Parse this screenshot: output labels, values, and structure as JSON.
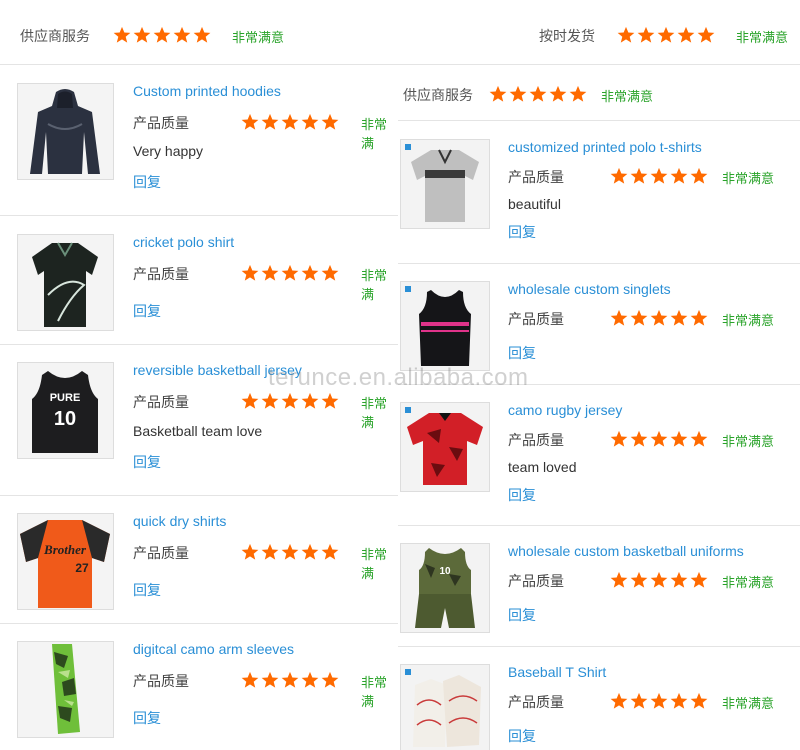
{
  "header": {
    "supplier_service_label": "供应商服务",
    "supplier_service_rating": "非常满意",
    "ontime_label": "按时发货",
    "ontime_rating": "非常满意"
  },
  "right_header": {
    "supplier_service_label": "供应商服务",
    "supplier_service_rating": "非常满意"
  },
  "left_reviews": [
    {
      "title": "Custom printed hoodies",
      "quality_label": "产品质量",
      "rating": "非常满",
      "comment": "Very happy",
      "reply": "回复"
    },
    {
      "title": "cricket polo shirt",
      "quality_label": "产品质量",
      "rating": "非常满",
      "comment": "",
      "reply": "回复"
    },
    {
      "title": "reversible basketball jersey",
      "quality_label": "产品质量",
      "rating": "非常满",
      "comment": "Basketball team love",
      "reply": "回复"
    },
    {
      "title": "quick dry shirts",
      "quality_label": "产品质量",
      "rating": "非常满",
      "comment": "",
      "reply": "回复"
    },
    {
      "title": "digitcal camo arm sleeves",
      "quality_label": "产品质量",
      "rating": "非常满",
      "comment": "",
      "reply": "回复"
    }
  ],
  "right_reviews": [
    {
      "title": "customized printed polo t-shirts",
      "quality_label": "产品质量",
      "rating": "非常满意",
      "comment": "beautiful",
      "reply": "回复"
    },
    {
      "title": "wholesale custom singlets",
      "quality_label": "产品质量",
      "rating": "非常满意",
      "comment": "",
      "reply": "回复"
    },
    {
      "title": "camo rugby jersey",
      "quality_label": "产品质量",
      "rating": "非常满意",
      "comment": "team loved",
      "reply": "回复"
    },
    {
      "title": "wholesale custom basketball uniforms",
      "quality_label": "产品质量",
      "rating": "非常满意",
      "comment": "",
      "reply": "回复"
    },
    {
      "title": "Baseball T Shirt",
      "quality_label": "产品质量",
      "rating": "非常满意",
      "comment": "",
      "reply": "回复"
    }
  ],
  "jersey_prints": {
    "pure": "PURE",
    "number": "10",
    "brother": "Brother",
    "number2": "27"
  },
  "watermark": "terunce.en.alibaba.com",
  "colors": {
    "star": "#ff6a00",
    "satisfied": "#2aa32a",
    "link": "#2a8fd6"
  }
}
